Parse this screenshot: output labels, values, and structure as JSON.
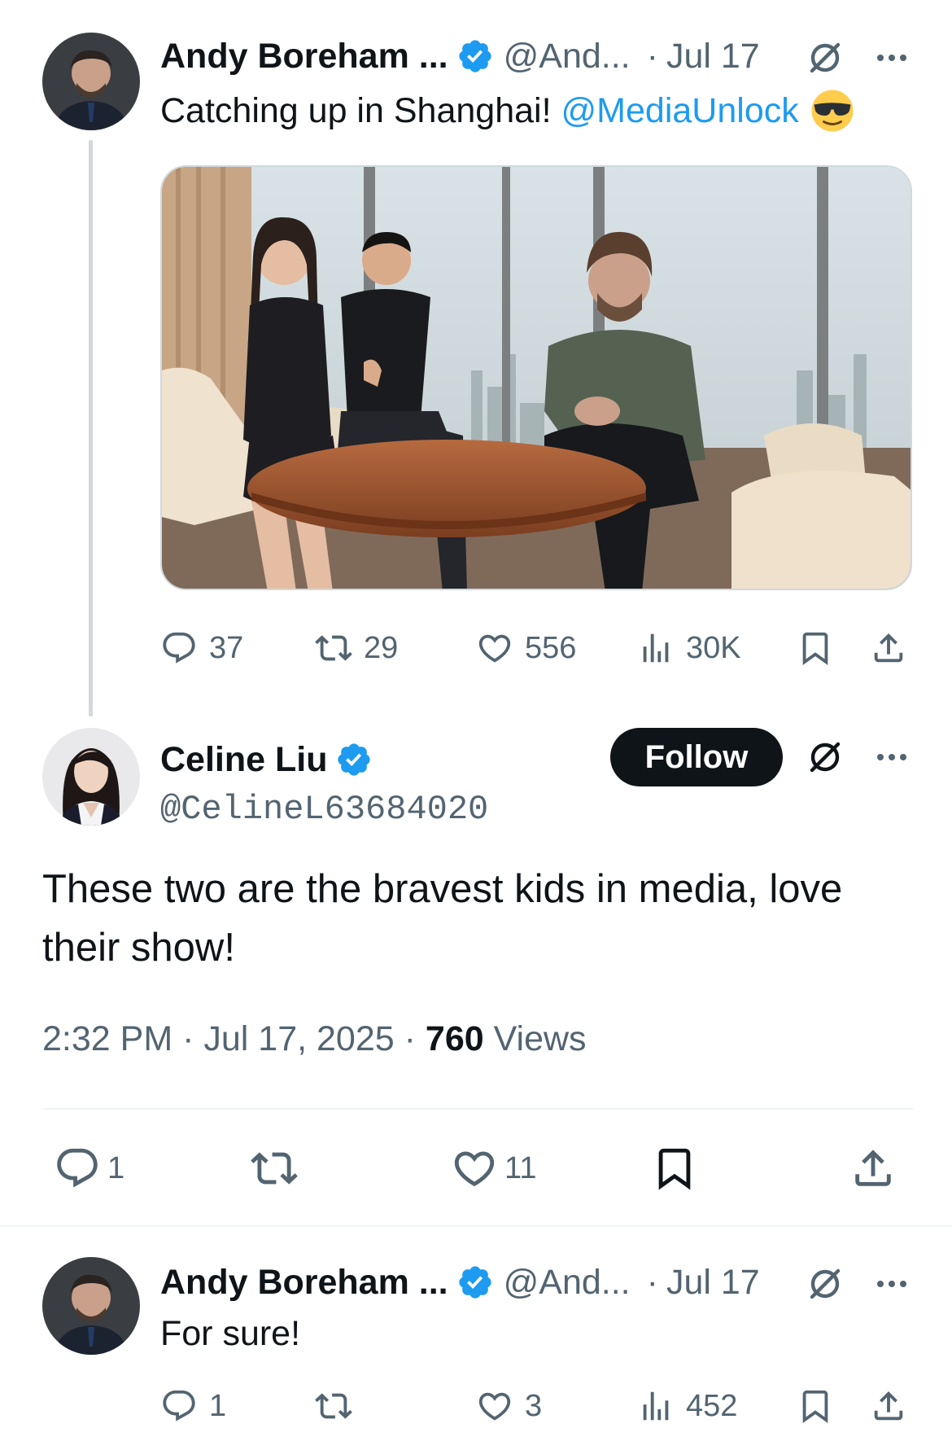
{
  "colors": {
    "accent": "#1d9bf0",
    "text": "#0f1419",
    "muted": "#536471",
    "divider": "#eff3f4"
  },
  "tweets": [
    {
      "author": "Andy Boreham ...",
      "handle": "@And...",
      "separator": "·",
      "date": "Jul 17",
      "text": "Catching up in Shanghai!",
      "mention": "@MediaUnlock",
      "emoji": "smiling-face-with-sunglasses",
      "stats": {
        "replies": "37",
        "reposts": "29",
        "likes": "556",
        "views": "30K"
      }
    },
    {
      "author": "Andy Boreham ...",
      "handle": "@And...",
      "separator": "·",
      "date": "Jul 17",
      "text": "For sure!",
      "stats": {
        "replies": "1",
        "reposts": "",
        "likes": "3",
        "views": "452"
      }
    }
  ],
  "focused": {
    "author": "Celine Liu",
    "handle": "@CelineL63684020",
    "follow_label": "Follow",
    "text": "These two are the bravest kids in media, love their show!",
    "time": "2:32 PM",
    "sep": "·",
    "date": "Jul 17, 2025",
    "sep2": "·",
    "views_count": "760",
    "views_label": "Views",
    "stats": {
      "replies": "1",
      "reposts": "",
      "likes": "11"
    }
  },
  "icons": [
    "reply-icon",
    "repost-icon",
    "like-icon",
    "views-icon",
    "bookmark-icon",
    "share-icon",
    "grok-icon",
    "more-icon",
    "verified-badge-icon"
  ]
}
